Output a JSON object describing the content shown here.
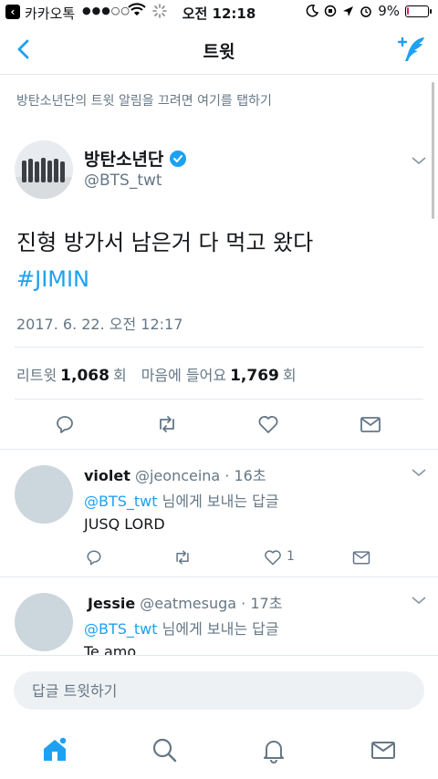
{
  "status_bar": {
    "back_app": "카카오톡",
    "signal": "●●●○○",
    "time": "오전 12:18",
    "battery": "9%",
    "battery_level": 0.09
  },
  "nav": {
    "title": "트윗"
  },
  "notice": "방탄소년단의 트윗 알림을 끄려면 여기를 탭하기",
  "tweet": {
    "name": "방탄소년단",
    "handle": "@BTS_twt",
    "text": "진형 방가서 남은거 다 먹고 왔다",
    "hashtag": "#JIMIN",
    "date": "2017. 6. 22. 오전 12:17",
    "retweets_label": "리트윗",
    "retweets": "1,068",
    "retweets_unit": "회",
    "likes_label": "마음에 들어요",
    "likes": "1,769",
    "likes_unit": "회"
  },
  "replies": [
    {
      "name": "violet",
      "handle": "@jeonceina",
      "time": "· 16초",
      "reply_to": "@BTS_twt",
      "reply_to_suffix": "님에게 보내는 답글",
      "body": "JUSQ LORD",
      "like_count": "1"
    },
    {
      "name": "Jessie",
      "handle": "@eatmesuga",
      "time": "· 17초",
      "reply_to": "@BTS_twt",
      "reply_to_suffix": "님에게 보내는 답글",
      "body": "Te amo"
    }
  ],
  "reply_box": {
    "placeholder": "답글 트윗하기"
  },
  "colors": {
    "accent": "#1da1f2",
    "secondary_text": "#657786",
    "divider": "#e1e8ed",
    "verified": "#1da1f2"
  },
  "icons": [
    "back-icon",
    "compose-icon",
    "verified-icon",
    "chevron-down-icon",
    "reply-icon",
    "retweet-icon",
    "like-icon",
    "dm-icon",
    "home-icon",
    "search-icon",
    "notifications-icon",
    "messages-icon"
  ]
}
